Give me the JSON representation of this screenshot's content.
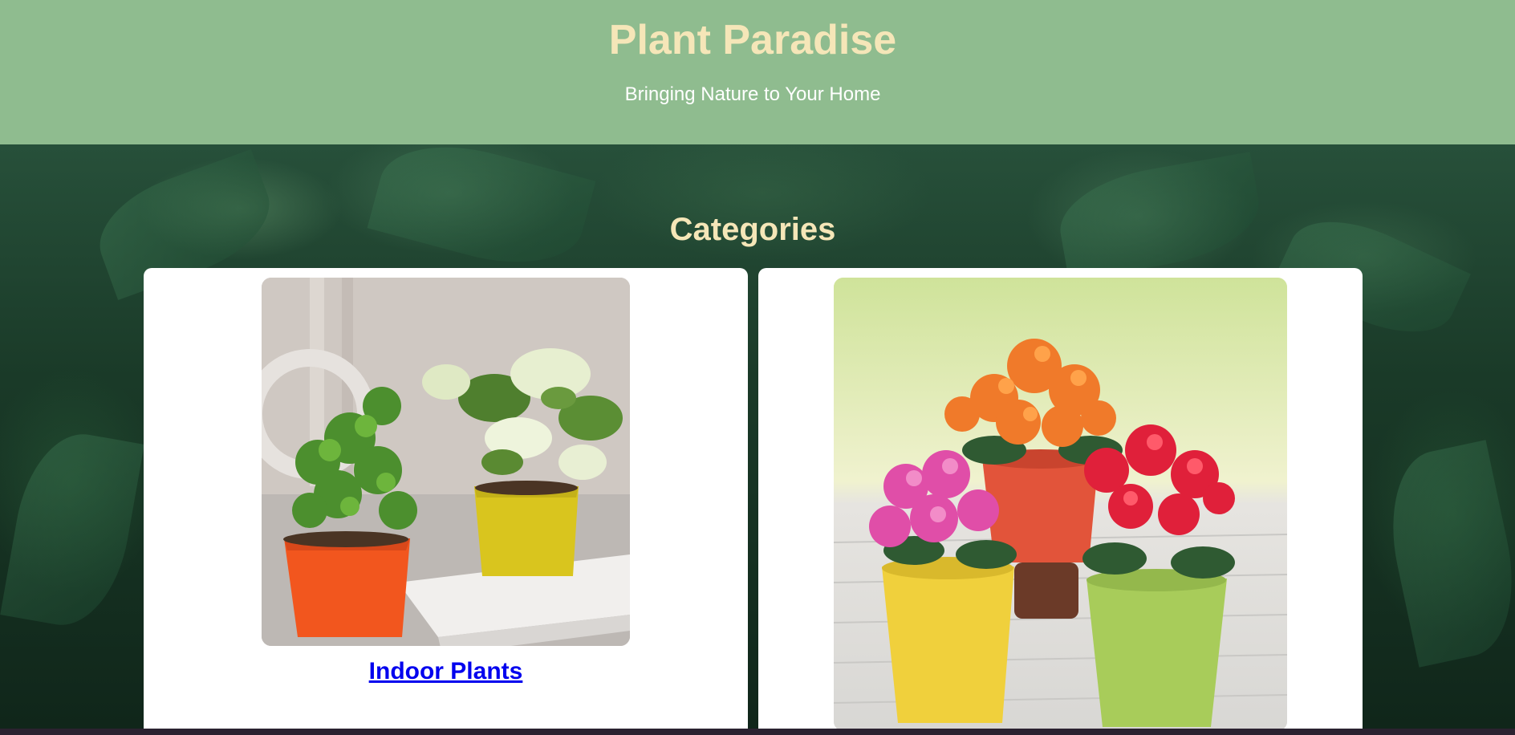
{
  "header": {
    "title": "Plant Paradise",
    "subtitle": "Bringing Nature to Your Home",
    "background_color": "#8fbc8f",
    "title_color": "#f5e6b8"
  },
  "main": {
    "heading": "Categories",
    "cards": [
      {
        "link_label": "Indoor Plants",
        "image": "potted-indoor-plants-photo"
      },
      {
        "link_label": "",
        "image": "potted-flowering-plants-photo"
      }
    ]
  },
  "colors": {
    "link": "#0000ee",
    "card": "#ffffff",
    "hero_background": "#1a3a28"
  }
}
